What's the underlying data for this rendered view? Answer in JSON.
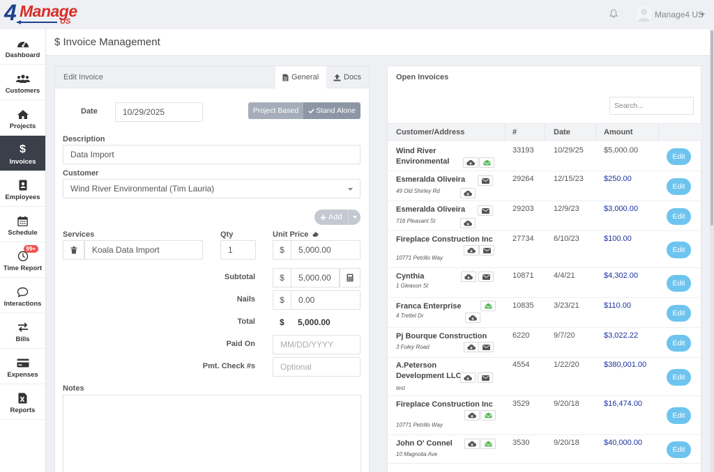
{
  "brand": {
    "logo_four": "4",
    "logo_manage": "Manage",
    "logo_us": "US"
  },
  "topbar": {
    "user_name": "Manage4 US"
  },
  "sidebar": {
    "items": [
      {
        "label": "Dashboard",
        "icon": "dashboard-icon"
      },
      {
        "label": "Customers",
        "icon": "users-icon"
      },
      {
        "label": "Projects",
        "icon": "home-icon"
      },
      {
        "label": "Invoices",
        "icon": "dollar-icon",
        "active": true
      },
      {
        "label": "Employees",
        "icon": "badge-icon"
      },
      {
        "label": "Schedule",
        "icon": "calendar-icon"
      },
      {
        "label": "Time Report",
        "icon": "clock-icon",
        "badge": "99+"
      },
      {
        "label": "Interactions",
        "icon": "chat-icon"
      },
      {
        "label": "Bills",
        "icon": "exchange-icon"
      },
      {
        "label": "Expenses",
        "icon": "credit-card-icon"
      },
      {
        "label": "Reports",
        "icon": "excel-icon"
      }
    ]
  },
  "page": {
    "title": "$ Invoice Management"
  },
  "edit_invoice": {
    "header": "Edit Invoice",
    "tabs": {
      "general": "General",
      "docs": "Docs"
    },
    "date_label": "Date",
    "date_value": "10/29/2025",
    "mode_project": "Project Based",
    "mode_standalone": "Stand Alone",
    "description_label": "Description",
    "description_value": "Data Import",
    "customer_label": "Customer",
    "customer_value": "Wind River Environmental (Tim Lauria)",
    "add_label": "Add",
    "services_label": "Services",
    "qty_label": "Qty",
    "unit_price_label": "Unit Price",
    "service_value": "Koala Data Import",
    "qty_value": "1",
    "currency": "$",
    "unit_price_value": "5,000.00",
    "subtotal_label": "Subtotal",
    "subtotal_value": "5,000.00",
    "nails_label": "Nails",
    "nails_value": "0.00",
    "total_label": "Total",
    "total_value": "5,000.00",
    "paid_on_label": "Paid On",
    "paid_on_placeholder": "MM/DD/YYYY",
    "check_label": "Pmt. Check #s",
    "check_placeholder": "Optional",
    "notes_label": "Notes"
  },
  "open_invoices": {
    "title": "Open Invoices",
    "search_placeholder": "Search...",
    "columns": {
      "customer": "Customer/Address",
      "number": "#",
      "date": "Date",
      "amount": "Amount"
    },
    "edit_label": "Edit",
    "rows": [
      {
        "name": "Wind River Environmental",
        "address": "",
        "number": "33193",
        "date": "10/29/25",
        "amount": "$5,000.00",
        "amount_style": "plain",
        "icons": [
          "cloud",
          "envelope-green"
        ]
      },
      {
        "name": "Esmeralda Oliveira",
        "address": "49 Old Shirley Rd",
        "number": "29264",
        "date": "12/15/23",
        "amount": "$250.00",
        "amount_style": "link",
        "icons": [
          "envelope",
          "cloud"
        ]
      },
      {
        "name": "Esmeralda Oliveira",
        "address": "716 Pleasant St",
        "number": "29203",
        "date": "12/9/23",
        "amount": "$3,000.00",
        "amount_style": "link",
        "icons": [
          "envelope",
          "cloud"
        ]
      },
      {
        "name": "Fireplace Construction Inc",
        "address": "10771 Petrillo Way",
        "number": "27734",
        "date": "6/10/23",
        "amount": "$100.00",
        "amount_style": "link",
        "icons": [
          "cloud",
          "envelope"
        ]
      },
      {
        "name": "Cynthia",
        "address": "1 Gleason St",
        "number": "10871",
        "date": "4/4/21",
        "amount": "$4,302.00",
        "amount_style": "link",
        "icons": [
          "cloud",
          "envelope"
        ]
      },
      {
        "name": "Franca Enterprise",
        "address": "4 Trettel Dr",
        "number": "10835",
        "date": "3/23/21",
        "amount": "$110.00",
        "amount_style": "link",
        "icons": [
          "envelope-green",
          "cloud"
        ]
      },
      {
        "name": "Pj Bourque Construction",
        "address": "3 Foley Road",
        "number": "6220",
        "date": "9/7/20",
        "amount": "$3,022.22",
        "amount_style": "link",
        "icons": [
          "cloud",
          "envelope"
        ]
      },
      {
        "name": "A.Peterson Development LLC",
        "address": "test",
        "number": "4554",
        "date": "1/22/20",
        "amount": "$380,001.00",
        "amount_style": "link",
        "icons": [
          "cloud",
          "envelope"
        ]
      },
      {
        "name": "Fireplace Construction Inc",
        "address": "10771 Petrillo Way",
        "number": "3529",
        "date": "9/20/18",
        "amount": "$16,474.00",
        "amount_style": "link",
        "icons": [
          "cloud",
          "envelope-green"
        ]
      },
      {
        "name": "John O' Connel",
        "address": "10 Magnolia Ave",
        "number": "3530",
        "date": "9/20/18",
        "amount": "$40,000.00",
        "amount_style": "link",
        "icons": [
          "cloud",
          "envelope-green"
        ]
      }
    ]
  },
  "colors": {
    "accent_edit": "#6cc4ef",
    "amount_link": "#1a2fa0",
    "sidebar_active": "#3a3f4a",
    "envelope_green": "#5cb85c"
  }
}
